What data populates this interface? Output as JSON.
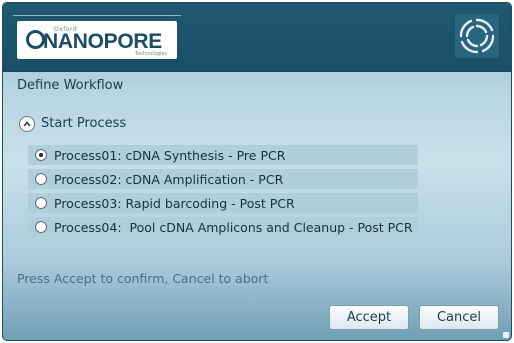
{
  "logo": {
    "top_text": "Oxford",
    "main_text": "NANOPORE",
    "sub_text": "Technologies"
  },
  "dialog": {
    "title": "Define Workflow",
    "group_label": "Start Process",
    "options": [
      {
        "label": "Process01: cDNA Synthesis - Pre PCR",
        "selected": true
      },
      {
        "label": "Process02: cDNA Amplification - PCR",
        "selected": false
      },
      {
        "label": "Process03: Rapid barcoding - Post PCR",
        "selected": false
      },
      {
        "label": "Process04:  Pool cDNA Amplicons and Cleanup - Post PCR",
        "selected": false
      }
    ],
    "hint": "Press Accept to confirm, Cancel to abort",
    "accept_label": "Accept",
    "cancel_label": "Cancel"
  },
  "colors": {
    "header": "#1f5870",
    "option_background": "#b1cedb",
    "text": "#1d3c4c"
  },
  "icons": [
    "nanopore-logo-icon",
    "swirl-logo-icon",
    "collapse-chevron-icon",
    "radio-icon"
  ]
}
